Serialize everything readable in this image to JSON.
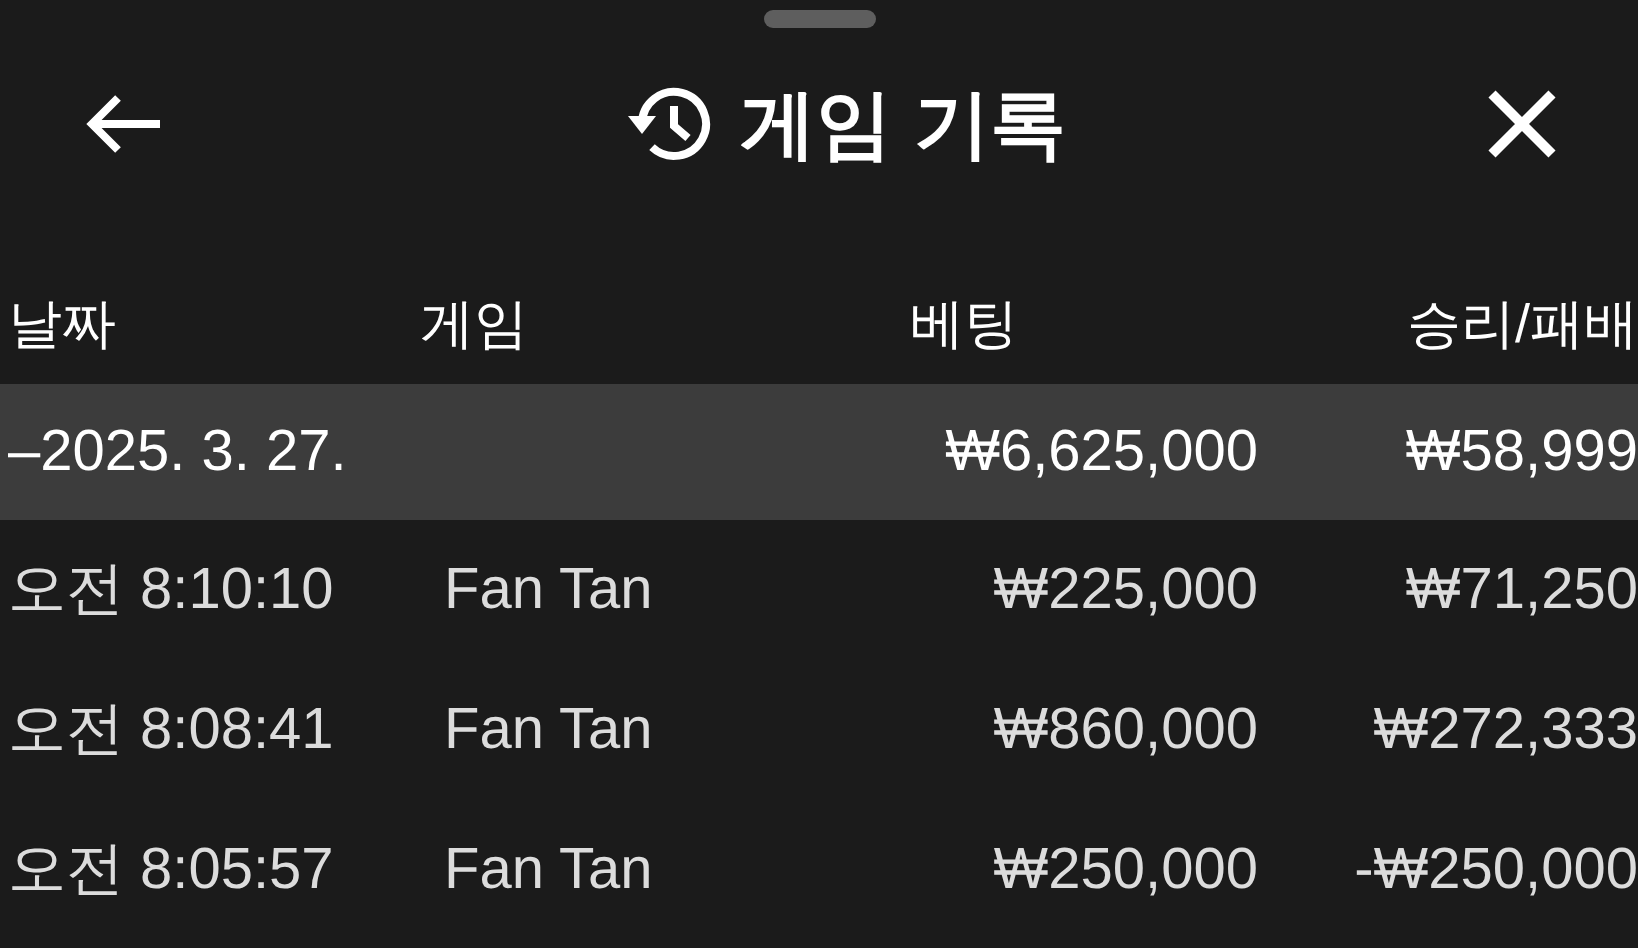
{
  "header": {
    "title": "게임 기록"
  },
  "table": {
    "columns": [
      {
        "label": "날짜"
      },
      {
        "label": "게임"
      },
      {
        "label": "베팅"
      },
      {
        "label": "승리/패배"
      }
    ],
    "groups": [
      {
        "date": "–2025. 3. 27.",
        "bet": "₩6,625,000",
        "result": "₩58,999",
        "rows": [
          {
            "time": "오전 8:10:10",
            "game": "Fan Tan",
            "bet": "₩225,000",
            "result": "₩71,250"
          },
          {
            "time": "오전 8:08:41",
            "game": "Fan Tan",
            "bet": "₩860,000",
            "result": "₩272,333"
          },
          {
            "time": "오전 8:05:57",
            "game": "Fan Tan",
            "bet": "₩250,000",
            "result": "-₩250,000"
          }
        ]
      }
    ]
  }
}
